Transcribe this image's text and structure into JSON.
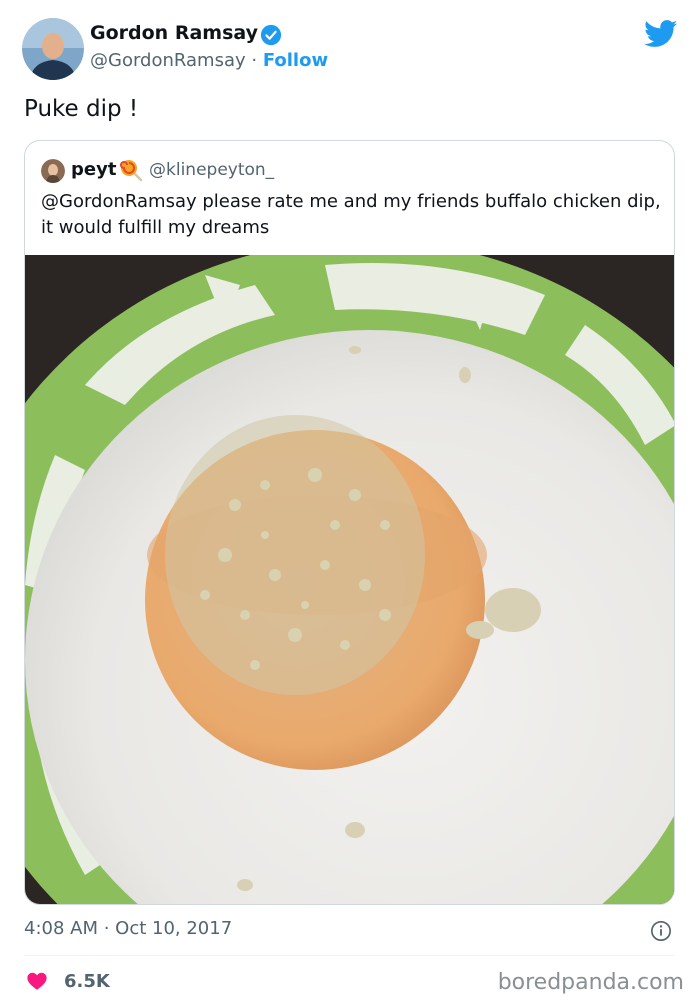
{
  "author": {
    "name": "Gordon Ramsay",
    "handle": "@GordonRamsay",
    "separator": " · ",
    "follow_label": "Follow"
  },
  "tweet": {
    "text": "Puke dip !"
  },
  "quoted": {
    "name": "peyt",
    "handle": "@klinepeyton_",
    "text": "@GordonRamsay please rate me and my friends buffalo chicken dip, it would fulfill my dreams"
  },
  "meta": {
    "timestamp": "4:08 AM · Oct 10, 2017",
    "likes": "6.5K"
  },
  "watermark": "boredpanda.com",
  "icons": {
    "verified": "verified-badge-icon",
    "brand": "twitter-bird-icon",
    "emoji": "lollipop-emoji-icon",
    "info": "info-icon",
    "like": "heart-icon"
  },
  "colors": {
    "accent": "#1d9bf0",
    "heart": "#f91880",
    "text_secondary": "#536471",
    "border": "#cfd9de"
  }
}
